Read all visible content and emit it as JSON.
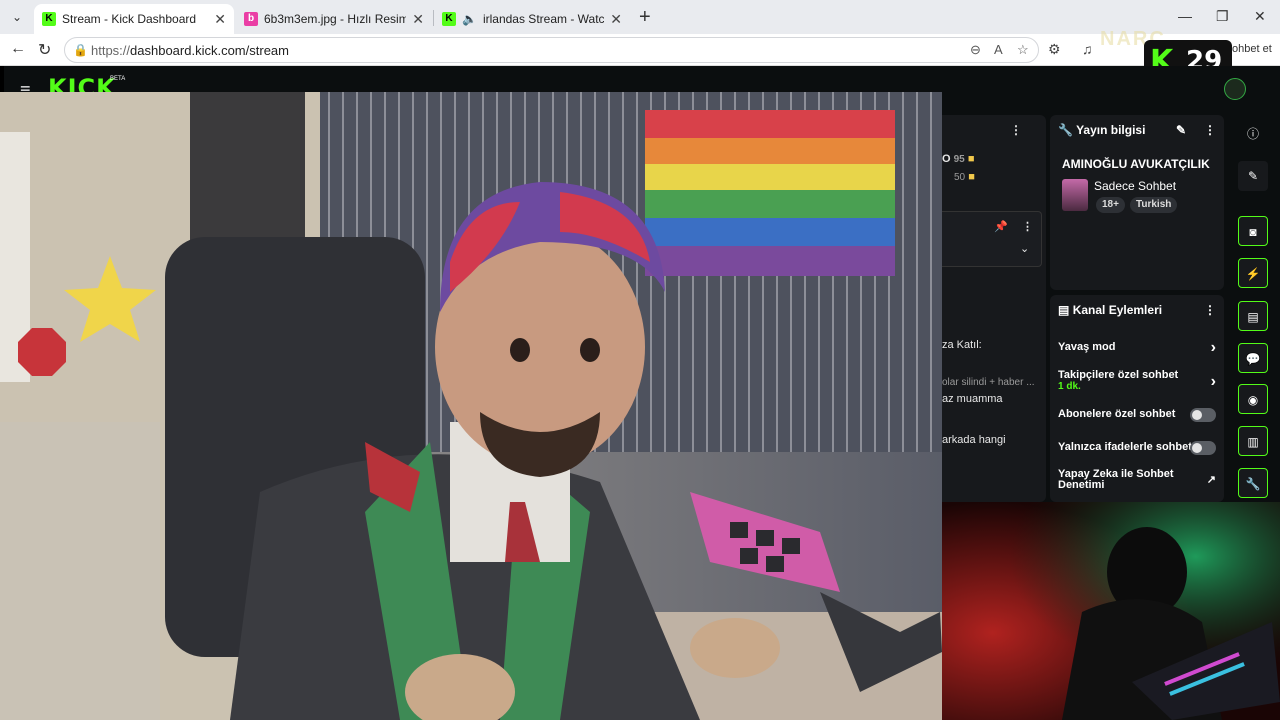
{
  "browser": {
    "tabs": [
      {
        "title": "Stream - Kick Dashboard",
        "active": true
      },
      {
        "title": "6b3m3em.jpg - Hızlı Resim",
        "active": false
      },
      {
        "title": "irlandas Stream - Watch Live o",
        "active": false
      }
    ],
    "url_prefix": "https://",
    "url_host": "dashboard.kick.com/stream",
    "overlay_label": "ohbet et",
    "overlay_number": "29"
  },
  "kick": {
    "logo": "KICK",
    "beta": "BETA"
  },
  "middle_panel": {
    "lines": [
      {
        "text": "O",
        "value": "95"
      },
      {
        "text": "",
        "value": "50"
      }
    ],
    "chat": [
      "za Katıl:",
      "olar silindi + haber ...",
      "az muamma",
      "arkada hangi"
    ]
  },
  "stream_info": {
    "header": "Yayın bilgisi",
    "title": "AMINOĞLU AVUKATÇILIK",
    "category": "Sadece Sohbet",
    "tags": [
      "18+",
      "Turkish"
    ]
  },
  "channel_actions": {
    "header": "Kanal Eylemleri",
    "items": [
      {
        "label": "Yavaş mod",
        "type": "chevron"
      },
      {
        "label": "Takipçilere özel sohbet",
        "sub": "1 dk.",
        "type": "chevron"
      },
      {
        "label": "Abonelere özel sohbet",
        "type": "toggle"
      },
      {
        "label": "Yalnızca ifadelerle sohbet",
        "type": "toggle"
      },
      {
        "label": "Yapay Zeka ile Sohbet Denetimi",
        "type": "external"
      }
    ]
  },
  "colors": {
    "kick_green": "#53fc18",
    "panel_bg": "#17191c",
    "page_bg": "#0b0e0f"
  }
}
